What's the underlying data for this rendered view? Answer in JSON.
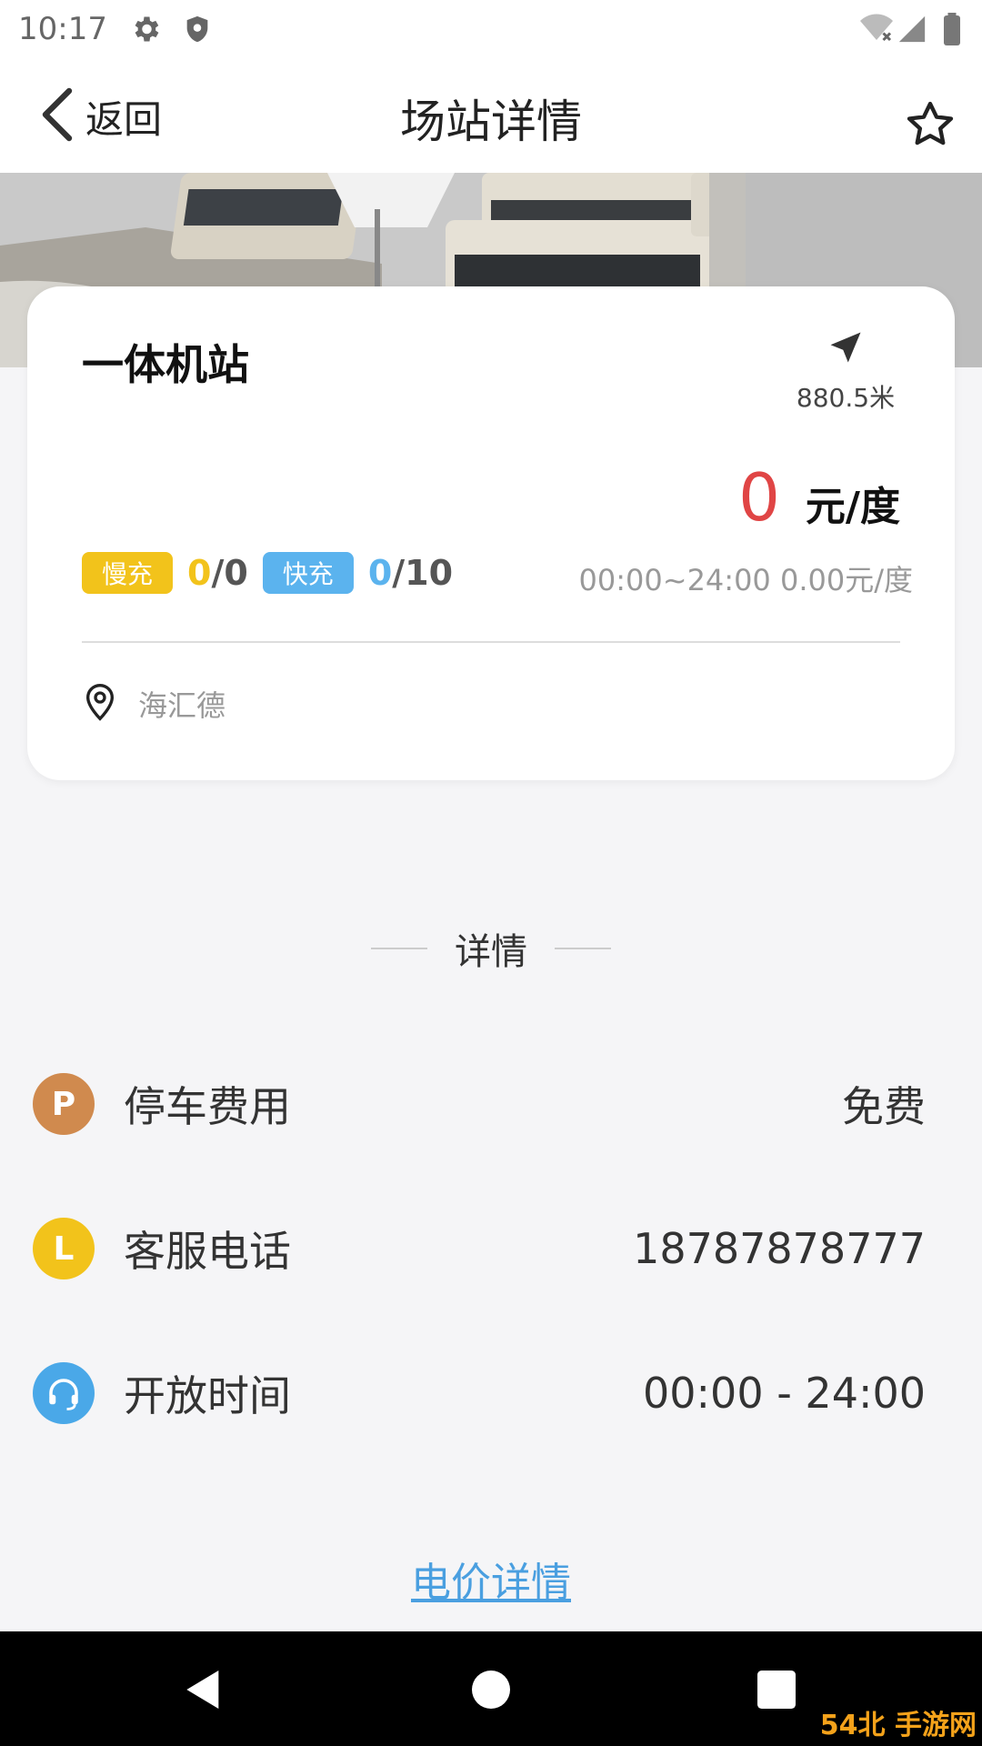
{
  "status_bar": {
    "time": "10:17",
    "icons": [
      "gear-icon",
      "shield-icon",
      "wifi-off-icon",
      "signal-icon",
      "battery-icon"
    ]
  },
  "header": {
    "back_label": "返回",
    "title": "场站详情",
    "favorite_icon": "star-outline-icon"
  },
  "station": {
    "name": "一体机站",
    "distance": "880.5米",
    "price_value": "0",
    "price_unit": "元/度",
    "slow_tag": "慢充",
    "slow_available": "0",
    "slow_total": "/0",
    "fast_tag": "快充",
    "fast_available": "0",
    "fast_total": "/10",
    "period_price": "00:00~24:00 0.00元/度",
    "address": "海汇德"
  },
  "details": {
    "section_title": "详情",
    "rows": [
      {
        "label": "停车费用",
        "value": "免费",
        "icon_text": "P",
        "icon_color": "#d08a4e"
      },
      {
        "label": "客服电话",
        "value": "18787878777",
        "icon_text": "L",
        "icon_color": "#f2c31b"
      },
      {
        "label": "开放时间",
        "value": "00:00 - 24:00",
        "icon_text": "",
        "icon_color": "#4aa8e8"
      }
    ],
    "price_detail_link": "电价详情"
  },
  "colors": {
    "price_red": "#e04545",
    "slow_yellow": "#f2c31b",
    "fast_blue": "#5bb3ee",
    "link_blue": "#4a9fe0"
  },
  "watermark": "54北 手游网"
}
